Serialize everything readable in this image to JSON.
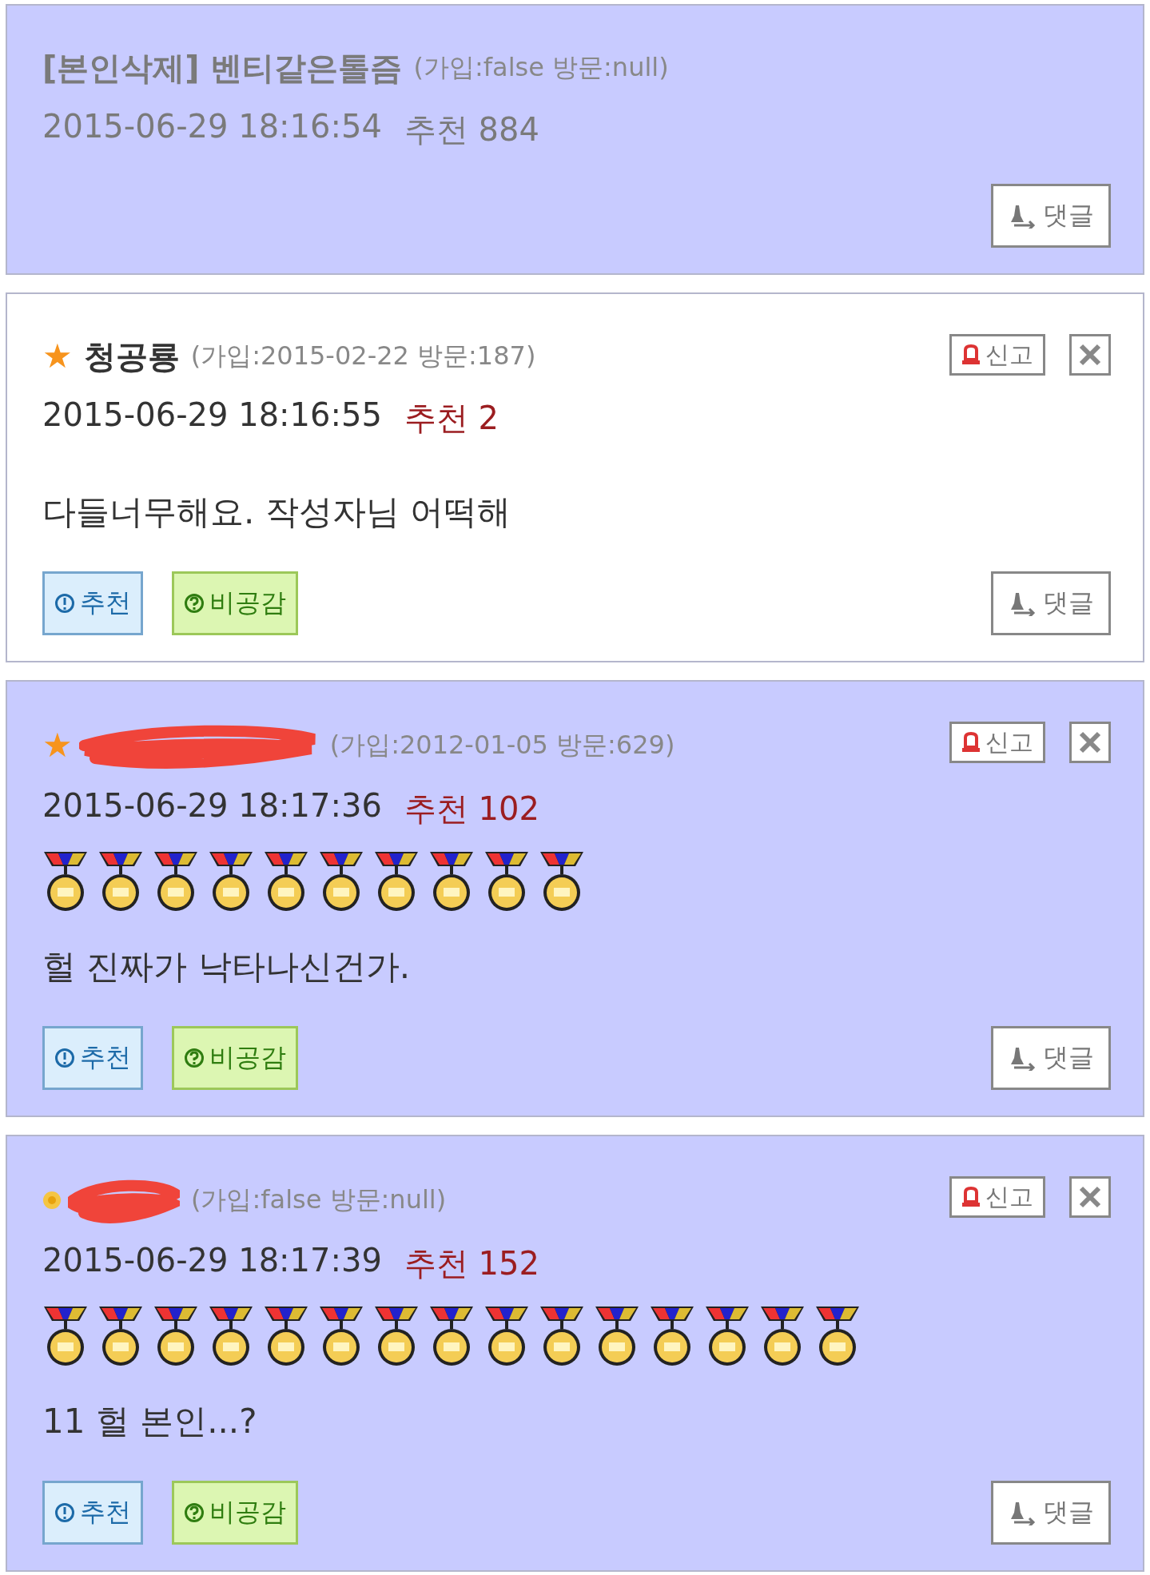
{
  "comments": [
    {
      "kind": "deleted",
      "name": "[본인삭제] 벤티같은톨즘",
      "meta": "(가입:false 방문:null)",
      "date": "2015-06-29 18:16:54",
      "recommend": "추천 884",
      "reply_label": "댓글"
    },
    {
      "kind": "normal",
      "badge": {
        "kind": "star",
        "text": "★"
      },
      "name": "청공룡",
      "meta": "(가입:2015-02-22 방문:187)",
      "date": "2015-06-29 18:16:55",
      "recommend": "추천 2",
      "body": "다들너무해요. 작성자님 어떡해",
      "report_label": "신고",
      "votes": [
        {
          "kind": "up",
          "label": "추천"
        },
        {
          "kind": "down",
          "label": "비공감"
        }
      ],
      "reply_label": "댓글",
      "selected": false
    },
    {
      "kind": "normal",
      "badge": {
        "kind": "star",
        "text": "★"
      },
      "redacted": true,
      "meta": "(가입:2012-01-05 방문:629)",
      "date": "2015-06-29 18:17:36",
      "recommend": "추천 102",
      "medals": [
        {
          "kind": "medal"
        },
        {
          "kind": "medal"
        },
        {
          "kind": "medal"
        },
        {
          "kind": "medal"
        },
        {
          "kind": "medal"
        },
        {
          "kind": "medal"
        },
        {
          "kind": "medal"
        },
        {
          "kind": "medal"
        },
        {
          "kind": "medal"
        },
        {
          "kind": "medal"
        }
      ],
      "body": "헐 진짜가 낙타나신건가.",
      "report_label": "신고",
      "votes": [
        {
          "kind": "up",
          "label": "추천"
        },
        {
          "kind": "down",
          "label": "비공감"
        }
      ],
      "reply_label": "댓글",
      "selected": true
    },
    {
      "kind": "normal",
      "badge": {
        "kind": "flower"
      },
      "redacted": true,
      "meta": "(가입:false 방문:null)",
      "date": "2015-06-29 18:17:39",
      "recommend": "추천 152",
      "medals": [
        {
          "kind": "medal"
        },
        {
          "kind": "medal"
        },
        {
          "kind": "medal"
        },
        {
          "kind": "medal"
        },
        {
          "kind": "medal"
        },
        {
          "kind": "medal"
        },
        {
          "kind": "medal"
        },
        {
          "kind": "medal"
        },
        {
          "kind": "medal"
        },
        {
          "kind": "medal"
        },
        {
          "kind": "medal"
        },
        {
          "kind": "medal"
        },
        {
          "kind": "medal"
        },
        {
          "kind": "medal"
        },
        {
          "kind": "medal"
        }
      ],
      "body": "11 헐 본인...?",
      "report_label": "신고",
      "votes": [
        {
          "kind": "up",
          "label": "추천"
        },
        {
          "kind": "down",
          "label": "비공감"
        }
      ],
      "reply_label": "댓글",
      "selected": true
    }
  ]
}
